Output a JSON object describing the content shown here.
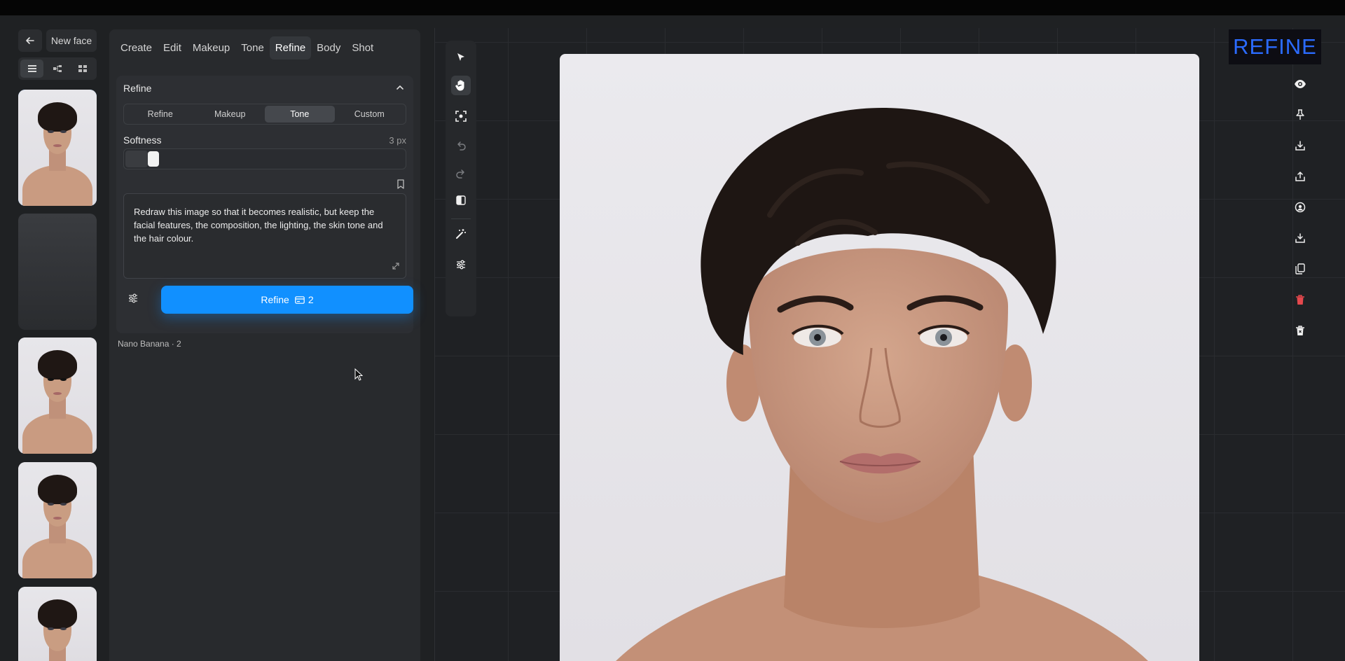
{
  "header": {
    "back_icon": "arrow-left-icon",
    "project_title": "New face",
    "view_modes": [
      "list-icon",
      "tree-icon",
      "grid-icon"
    ]
  },
  "thumbnails": [
    {
      "name": "thumbnail-1",
      "selected": true,
      "state": "image"
    },
    {
      "name": "thumbnail-2",
      "selected": false,
      "state": "empty"
    },
    {
      "name": "thumbnail-3",
      "selected": false,
      "state": "image"
    },
    {
      "name": "thumbnail-4",
      "selected": false,
      "state": "image"
    },
    {
      "name": "thumbnail-5",
      "selected": false,
      "state": "image"
    }
  ],
  "panel": {
    "tabs": [
      "Create",
      "Edit",
      "Makeup",
      "Tone",
      "Refine",
      "Body",
      "Shot"
    ],
    "active_tab": "Refine",
    "card": {
      "title": "Refine",
      "segments": [
        "Refine",
        "Makeup",
        "Tone",
        "Custom"
      ],
      "active_segment": "Tone",
      "softness_label": "Softness",
      "softness_value": "3 px",
      "softness_fraction": 0.08,
      "prompt_text": "Redraw this image so that it becomes realistic, but keep the facial features, the composition, the lighting, the skin tone and the hair colour.",
      "refine_button_label": "Refine",
      "refine_cost": "2"
    },
    "model_note": "Nano Banana · 2"
  },
  "toolbar_left": [
    "cursor-icon",
    "hand-icon",
    "focus-icon",
    "undo-icon",
    "redo-icon",
    "compare-icon",
    "magic-wand-icon",
    "sliders-icon"
  ],
  "toolbar_right": [
    "eye-icon",
    "pin-icon",
    "download-icon",
    "share-icon",
    "user-circle-icon",
    "save-icon",
    "copy-icon",
    "trash-icon",
    "delete-icon"
  ],
  "brand": {
    "label": "REFINE",
    "color": "#2b6bff"
  },
  "colors": {
    "accent": "#1190ff",
    "danger": "#e5484d",
    "selected_outline": "#3aa0ff"
  }
}
